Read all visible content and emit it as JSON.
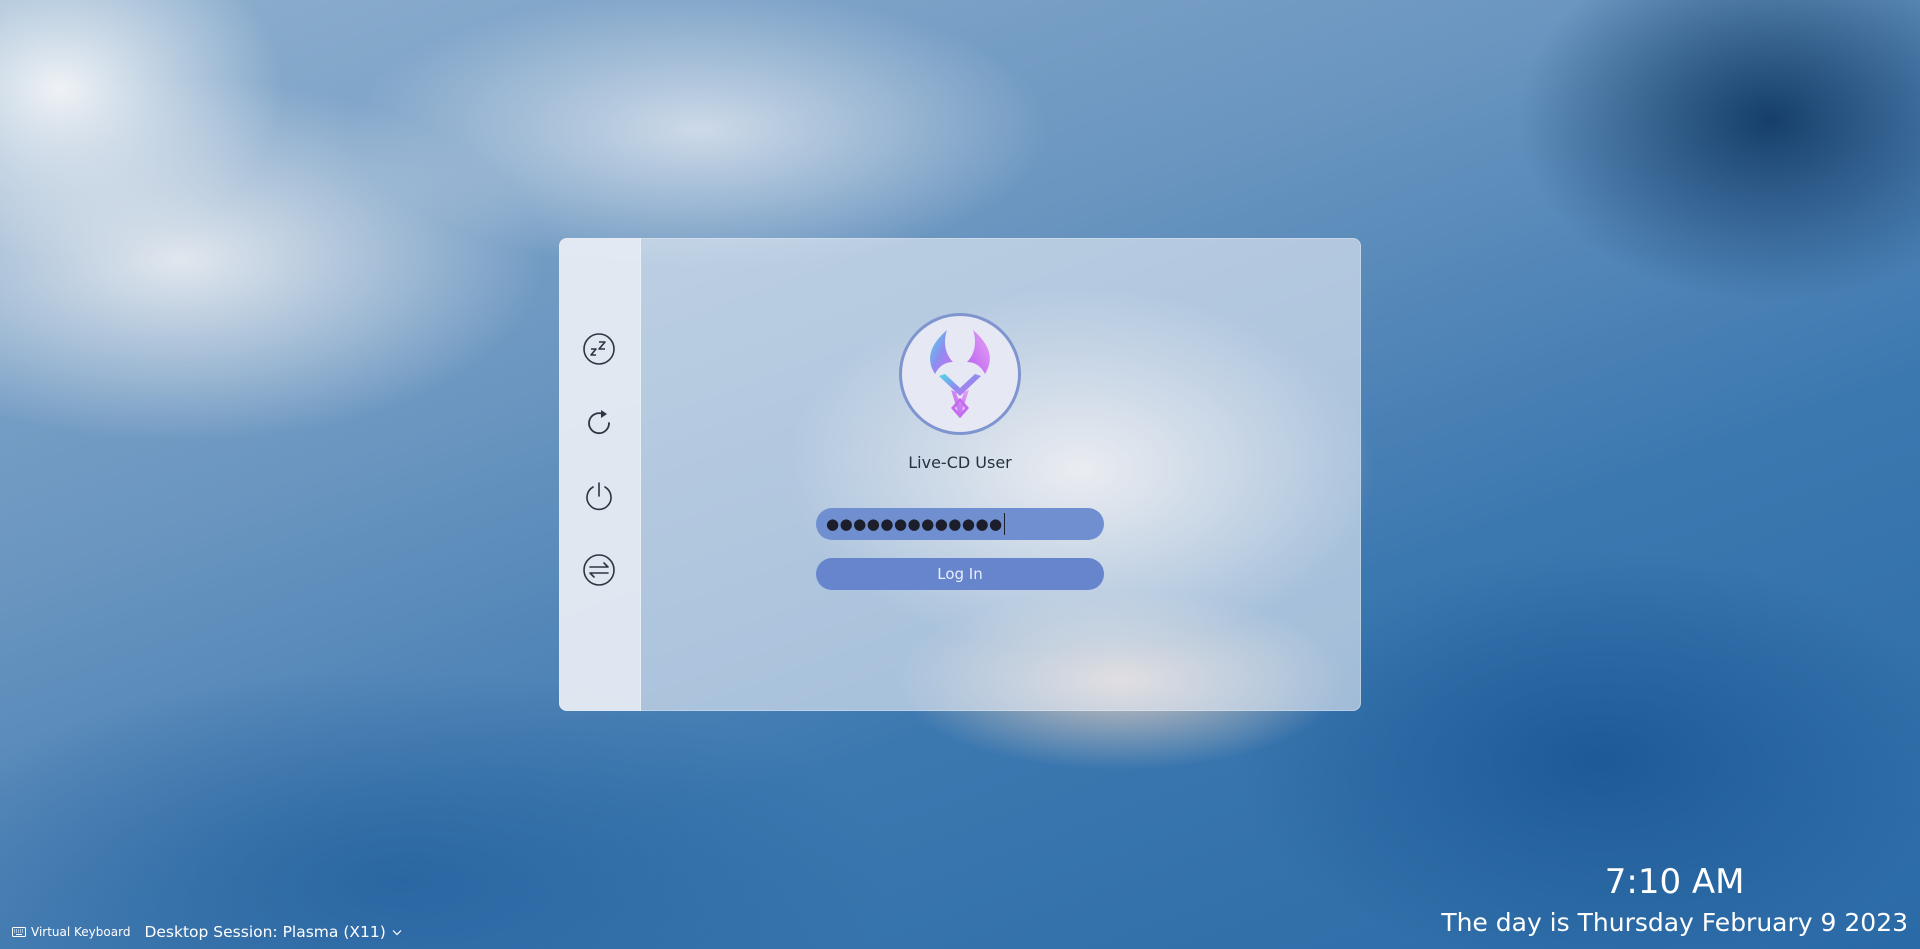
{
  "sidebar": {
    "actions": [
      {
        "icon": "sleep-icon"
      },
      {
        "icon": "restart-icon"
      },
      {
        "icon": "power-icon"
      },
      {
        "icon": "switch-user-icon"
      }
    ]
  },
  "user": {
    "name": "Live-CD User",
    "avatar_icon": "app-logo-icon"
  },
  "password": {
    "masked_value": "●●●●●●●●●●●●●"
  },
  "login": {
    "button_label": "Log In"
  },
  "footer": {
    "virtual_keyboard_label": "Virtual Keyboard",
    "session_label": "Desktop Session: Plasma (X11)"
  },
  "clock": {
    "time": "7:10 AM",
    "date": "The day is Thursday February 9 2023"
  },
  "colors": {
    "accent": "#6685cc",
    "password_field": "#6f8fd0",
    "avatar_border": "#7f95cf"
  }
}
